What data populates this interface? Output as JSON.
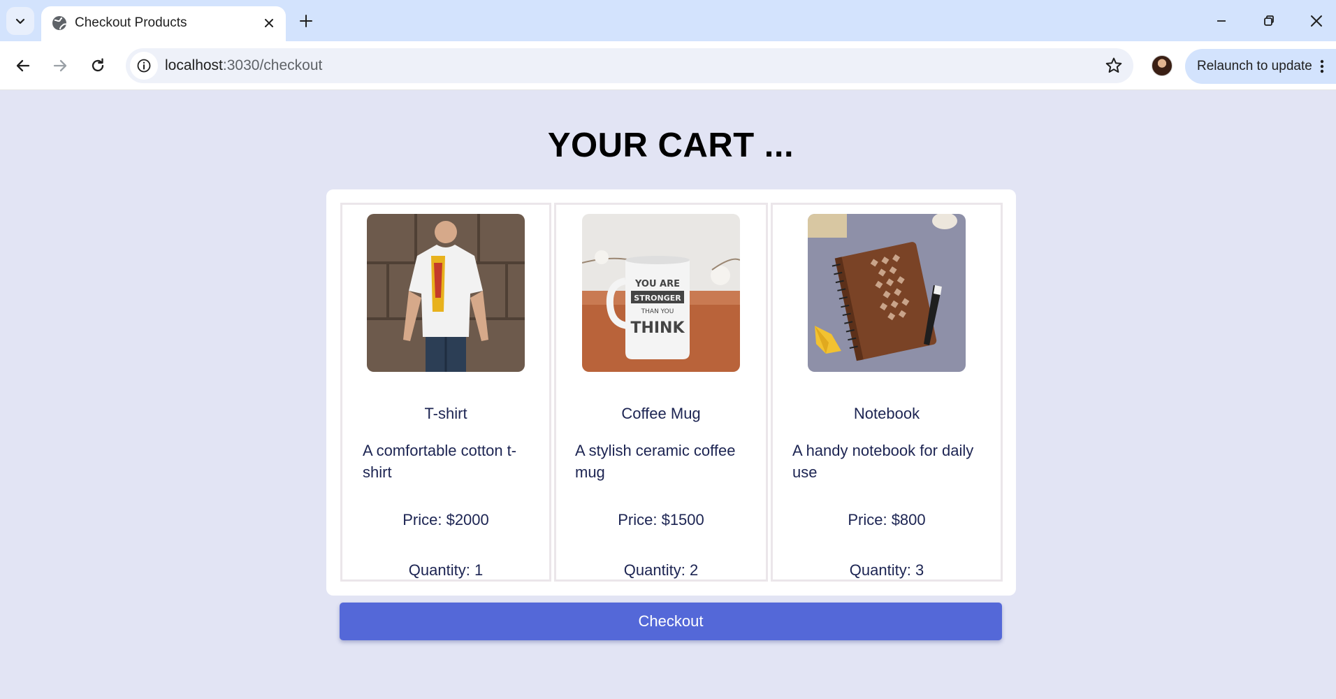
{
  "browser": {
    "tab_title": "Checkout Products",
    "url_host": "localhost",
    "url_path": ":3030/checkout",
    "relaunch_label": "Relaunch to update"
  },
  "page": {
    "title": "YOUR CART ..."
  },
  "cart": {
    "items": [
      {
        "name": "T-shirt",
        "description": "A comfortable cotton t-shirt",
        "price": "Price: $2000",
        "quantity": "Quantity: 1",
        "image": "tshirt-image"
      },
      {
        "name": "Coffee Mug",
        "description": "A stylish ceramic coffee mug",
        "price": "Price: $1500",
        "quantity": "Quantity: 2",
        "image": "coffee-mug-image"
      },
      {
        "name": "Notebook",
        "description": "A handy notebook for daily use",
        "price": "Price: $800",
        "quantity": "Quantity: 3",
        "image": "notebook-image"
      }
    ],
    "mug_print": [
      "YOU ARE",
      "STRONGER",
      "THAN YOU",
      "THINK"
    ],
    "checkout_label": "Checkout"
  },
  "colors": {
    "page_bg": "#e2e4f4",
    "tabstrip_bg": "#d3e3fd",
    "checkout_button": "#5468d8",
    "text_primary": "#1c2452"
  }
}
